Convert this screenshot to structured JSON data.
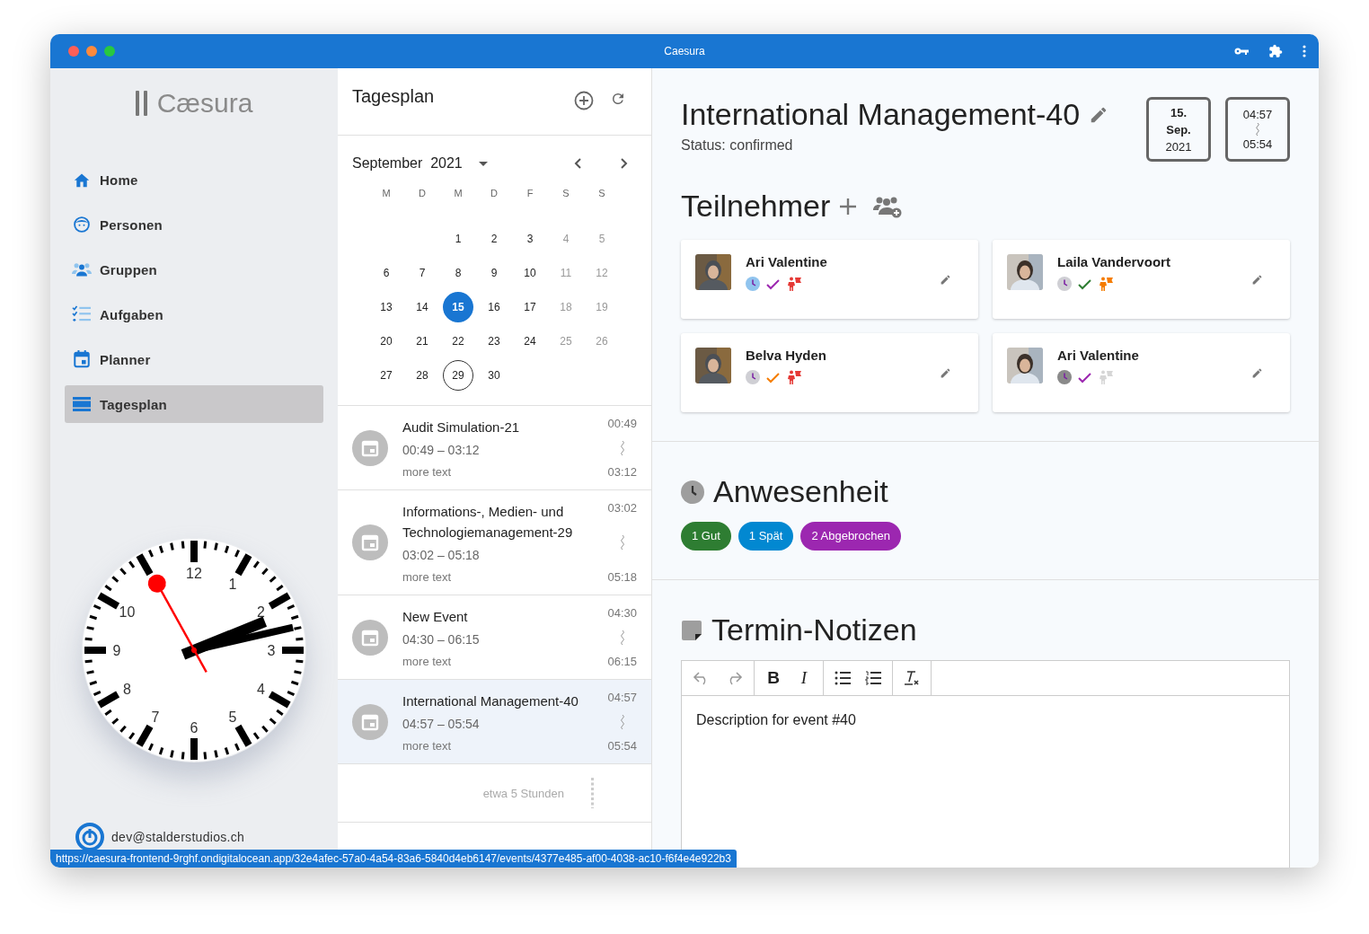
{
  "window": {
    "title": "Caesura"
  },
  "logo": {
    "text": "Cæsura"
  },
  "nav": [
    {
      "kind": "home",
      "label": "Home",
      "selected": false
    },
    {
      "kind": "person",
      "label": "Personen",
      "selected": false
    },
    {
      "kind": "group",
      "label": "Gruppen",
      "selected": false
    },
    {
      "kind": "tasks",
      "label": "Aufgaben",
      "selected": false
    },
    {
      "kind": "planner",
      "label": "Planner",
      "selected": false
    },
    {
      "kind": "dayplan",
      "label": "Tagesplan",
      "selected": true
    }
  ],
  "clock": {
    "numerals": [
      "12",
      "1",
      "2",
      "3",
      "4",
      "5",
      "6",
      "7",
      "8",
      "9",
      "10"
    ]
  },
  "account": {
    "email": "dev@stalderstudios.ch"
  },
  "dayplan": {
    "title": "Tagesplan",
    "calendar": {
      "month": "September",
      "year": "2021",
      "weekdays": [
        "M",
        "D",
        "M",
        "D",
        "F",
        "S",
        "S"
      ],
      "weeks": [
        [
          {
            "label": "1",
            "selected": false,
            "today": false
          },
          {
            "label": "2",
            "selected": false,
            "today": false
          },
          {
            "label": "3",
            "selected": false,
            "today": false
          },
          {
            "label": "4",
            "selected": false,
            "today": false
          },
          {
            "label": "5",
            "selected": false,
            "today": false
          }
        ],
        [
          {
            "label": "6",
            "selected": false,
            "today": false
          },
          {
            "label": "7",
            "selected": false,
            "today": false
          },
          {
            "label": "8",
            "selected": false,
            "today": false
          },
          {
            "label": "9",
            "selected": false,
            "today": false
          },
          {
            "label": "10",
            "selected": false,
            "today": false
          },
          {
            "label": "11",
            "selected": false,
            "today": false
          },
          {
            "label": "12",
            "selected": false,
            "today": false
          }
        ],
        [
          {
            "label": "13",
            "selected": false,
            "today": false
          },
          {
            "label": "14",
            "selected": false,
            "today": false
          },
          {
            "label": "15",
            "selected": true,
            "today": false
          },
          {
            "label": "16",
            "selected": false,
            "today": false
          },
          {
            "label": "17",
            "selected": false,
            "today": false
          },
          {
            "label": "18",
            "selected": false,
            "today": false
          },
          {
            "label": "19",
            "selected": false,
            "today": false
          }
        ],
        [
          {
            "label": "20",
            "selected": false,
            "today": false
          },
          {
            "label": "21",
            "selected": false,
            "today": false
          },
          {
            "label": "22",
            "selected": false,
            "today": false
          },
          {
            "label": "23",
            "selected": false,
            "today": false
          },
          {
            "label": "24",
            "selected": false,
            "today": false
          },
          {
            "label": "25",
            "selected": false,
            "today": false
          },
          {
            "label": "26",
            "selected": false,
            "today": false
          }
        ],
        [
          {
            "label": "27",
            "selected": false,
            "today": false
          },
          {
            "label": "28",
            "selected": false,
            "today": false
          },
          {
            "label": "29",
            "selected": false,
            "today": true
          },
          {
            "label": "30",
            "selected": false,
            "today": false
          }
        ]
      ]
    },
    "events": [
      {
        "title": "Audit Simulation-21",
        "range": "00:49 – 03:12",
        "note": "more text",
        "start": "00:49",
        "end": "03:12",
        "selected": false
      },
      {
        "title": "Informations-, Medien- und Technologiemanagement-29",
        "range": "03:02 – 05:18",
        "note": "more text",
        "start": "03:02",
        "end": "05:18",
        "selected": false
      },
      {
        "title": "New Event",
        "range": "04:30 – 06:15",
        "note": "more text",
        "start": "04:30",
        "end": "06:15",
        "selected": false
      },
      {
        "title": "International Management-40",
        "range": "04:57 – 05:54",
        "note": "more text",
        "start": "04:57",
        "end": "05:54",
        "selected": true
      }
    ],
    "gap": "etwa 5 Stunden"
  },
  "event": {
    "title": "International Management-40",
    "status": "Status: confirmed",
    "date": [
      "15.",
      "Sep.",
      "2021"
    ],
    "start": "04:57",
    "end": "05:54"
  },
  "participants": {
    "title": "Teilnehmer",
    "people": [
      {
        "name": "Ari Valentine",
        "status": [
          {
            "kind": "attendance",
            "color": "#90c4ee"
          },
          {
            "kind": "check",
            "color": "#9c27b0"
          },
          {
            "kind": "activity",
            "color": "#e53935"
          }
        ]
      },
      {
        "name": "Laila Vandervoort",
        "status": [
          {
            "kind": "attendance",
            "color": "#cfcfd4"
          },
          {
            "kind": "check",
            "color": "#2e7d32"
          },
          {
            "kind": "activity",
            "color": "#f57c00"
          }
        ]
      },
      {
        "name": "Belva Hyden",
        "status": [
          {
            "kind": "attendance",
            "color": "#cfcfd4"
          },
          {
            "kind": "check",
            "color": "#f57c00"
          },
          {
            "kind": "activity",
            "color": "#e53935"
          }
        ]
      },
      {
        "name": "Ari Valentine",
        "status": [
          {
            "kind": "attendance",
            "color": "#8a8a8a"
          },
          {
            "kind": "check",
            "color": "#9c27b0"
          },
          {
            "kind": "activity",
            "color": "#d6d6d6"
          }
        ]
      }
    ]
  },
  "attendance": {
    "title": "Anwesenheit",
    "chips": [
      {
        "label": "1 Gut",
        "color": "#2e7d32"
      },
      {
        "label": "1 Spät",
        "color": "#0288d1"
      },
      {
        "label": "2 Abgebrochen",
        "color": "#9c27b0"
      }
    ]
  },
  "notes": {
    "title": "Termin-Notizen",
    "toolbar": [
      [
        {
          "kind": "undo"
        },
        {
          "kind": "redo"
        }
      ],
      [
        {
          "kind": "bold",
          "label": "B"
        },
        {
          "kind": "italic",
          "label": "I"
        }
      ],
      [
        {
          "kind": "bullets"
        },
        {
          "kind": "numbers"
        }
      ],
      [
        {
          "kind": "clear"
        }
      ]
    ],
    "text": "Description for event #40"
  },
  "status_bar": {
    "url": "https://caesura-frontend-9rghf.ondigitalocean.app/32e4afec-57a0-4a54-83a6-5840d4eb6147/events/4377e485-af00-4038-ac10-f6f4e4e922b3"
  }
}
